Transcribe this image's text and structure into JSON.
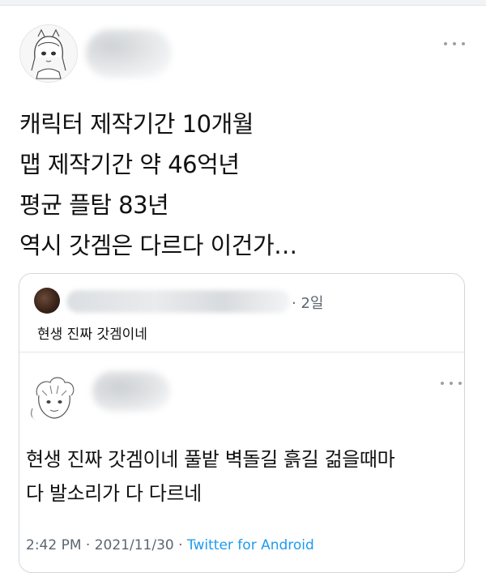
{
  "tweet": {
    "lines": [
      "캐릭터 제작기간 10개월",
      "맵 제작기간 약 46억년",
      "평균 플탐 83년",
      "역시 갓겜은 다르다 이건가…"
    ],
    "more_icon": "more-horizontal-icon"
  },
  "quote": {
    "time": "· 2일",
    "reply_text": "현생 진짜 갓겜이네",
    "inner_tweet": {
      "lines": [
        "현생 진짜 갓겜이네 풀밭 벽돌길 흙길 걺을때마",
        "다 발소리가 다 다르네"
      ],
      "time": "2:42 PM",
      "separator": "·",
      "date": "2021/11/30",
      "source": "Twitter for Android"
    }
  },
  "colors": {
    "link_blue": "#1d9bf0",
    "muted_gray": "#5b6670",
    "border": "#d4d8db"
  }
}
